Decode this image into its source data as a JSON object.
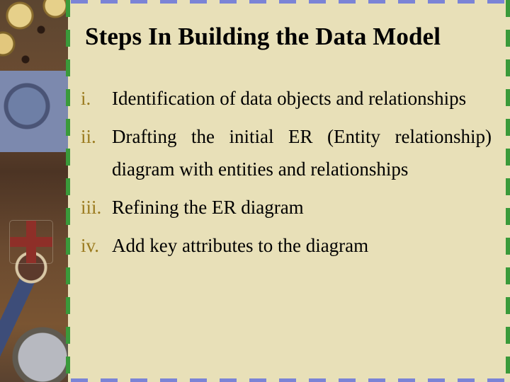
{
  "slide": {
    "title": "Steps In Building the Data Model",
    "colors": {
      "background": "#e8e0b8",
      "number_color": "#9a7a1e",
      "border_side": "#3a9a3a",
      "border_top_bottom": "#7b84d6"
    },
    "items": [
      {
        "number": "i.",
        "text": "Identification of data objects and relationships"
      },
      {
        "number": "ii.",
        "text": "Drafting the initial ER (Entity relationship) diagram with entities and relationships"
      },
      {
        "number": "iii.",
        "text": "Refining the ER diagram"
      },
      {
        "number": "iv.",
        "text": "Add key attributes to the diagram"
      }
    ],
    "decorative_image": "medals-and-compass-photo"
  }
}
